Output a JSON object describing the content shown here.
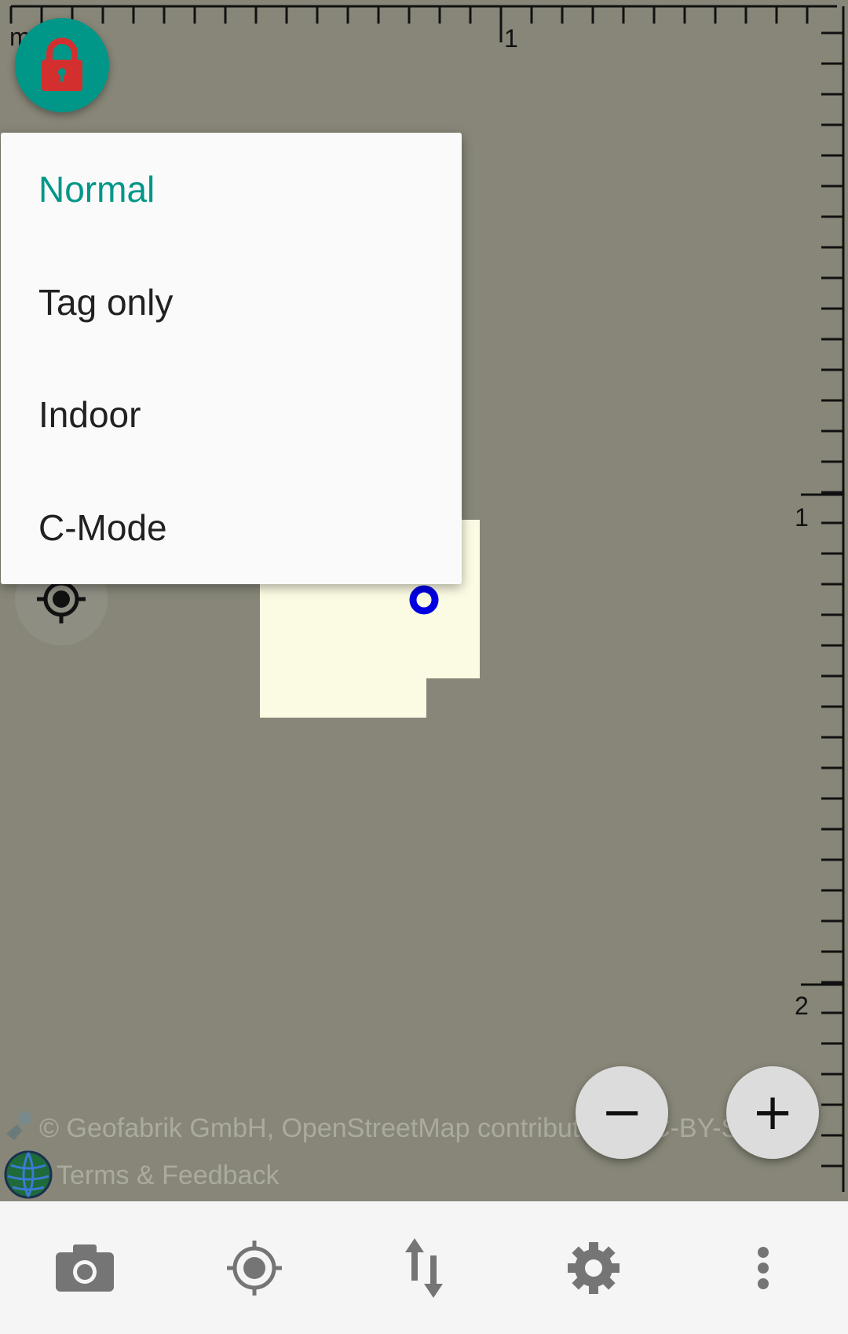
{
  "map": {
    "background": "#878678",
    "building_color": "#fbfbe3",
    "location_marker_color": "#0000e0"
  },
  "ruler": {
    "top_label_left": "m",
    "top_label_1": "1",
    "right_label_1": "1",
    "right_label_2": "2"
  },
  "lock_button": {
    "icon": "lock-icon",
    "color": "#009688",
    "icon_color": "#d32f2f"
  },
  "mode_menu": {
    "items": [
      {
        "label": "Normal",
        "selected": true
      },
      {
        "label": "Tag only",
        "selected": false
      },
      {
        "label": "Indoor",
        "selected": false
      },
      {
        "label": "C-Mode",
        "selected": false
      }
    ],
    "selected_color": "#009688"
  },
  "gps_button": {
    "icon": "gps-crosshair-icon"
  },
  "zoom": {
    "out_label": "−",
    "in_label": "+"
  },
  "attribution": {
    "text": "© Geofabrik GmbH, OpenStreetMap contributors, CC-BY-SA",
    "terms": "Terms & Feedback"
  },
  "bottom_bar": {
    "items": [
      {
        "icon": "camera-icon"
      },
      {
        "icon": "gps-follow-icon"
      },
      {
        "icon": "transfer-icon"
      },
      {
        "icon": "settings-gear-icon"
      },
      {
        "icon": "overflow-menu-icon"
      }
    ]
  }
}
